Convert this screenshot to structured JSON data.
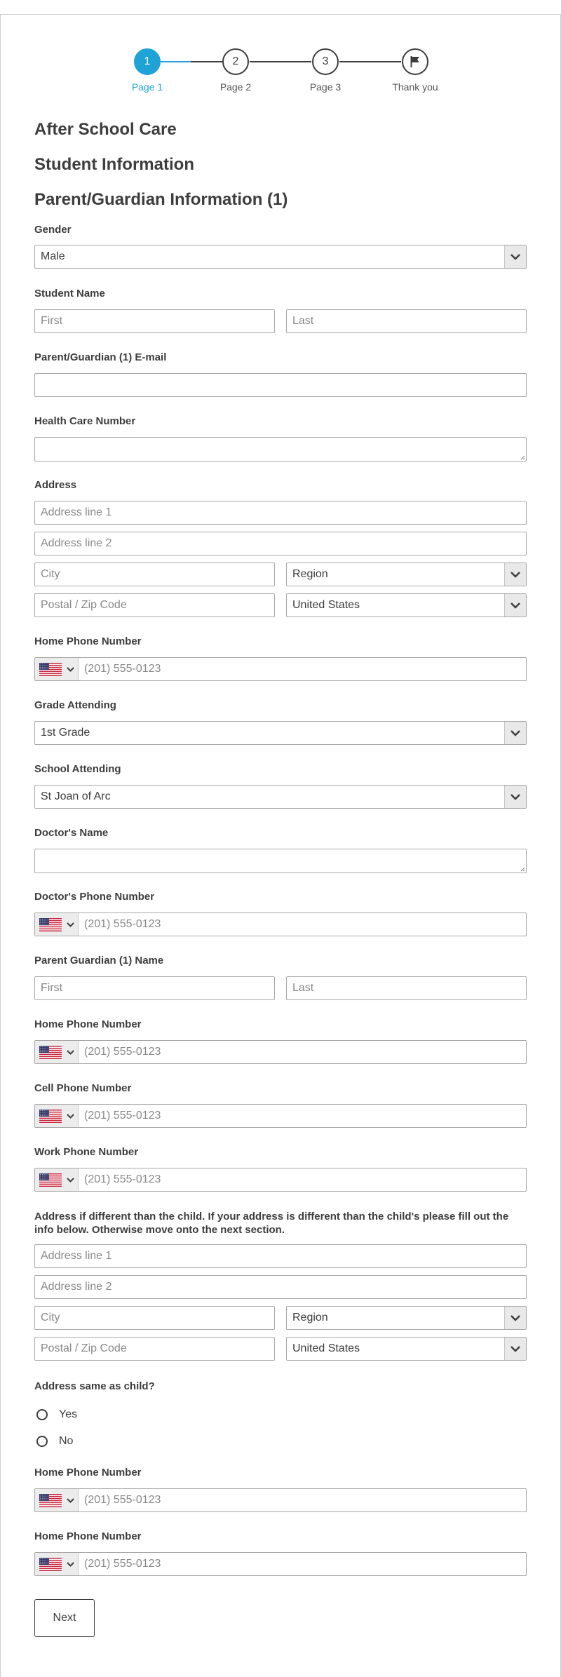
{
  "stepper": [
    {
      "number": "1",
      "label": "Page 1"
    },
    {
      "number": "2",
      "label": "Page 2"
    },
    {
      "number": "3",
      "label": "Page 3"
    },
    {
      "icon": "flag-icon",
      "label": "Thank you"
    }
  ],
  "headings": {
    "form_title": "After School Care",
    "section_student": "Student Information",
    "section_parent": "Parent/Guardian Information (1)"
  },
  "gender": {
    "label": "Gender",
    "value": "Male"
  },
  "student_name": {
    "label": "Student Name",
    "first_placeholder": "First",
    "last_placeholder": "Last"
  },
  "parent_email": {
    "label": "Parent/Guardian (1) E-mail",
    "value": ""
  },
  "health_care": {
    "label": "Health Care Number",
    "value": ""
  },
  "address": {
    "label": "Address",
    "line1_placeholder": "Address line 1",
    "line2_placeholder": "Address line 2",
    "city_placeholder": "City",
    "region_value": "Region",
    "postal_placeholder": "Postal / Zip Code",
    "country_value": "United States"
  },
  "home_phone": {
    "label": "Home Phone Number",
    "placeholder": "(201) 555-0123"
  },
  "grade": {
    "label": "Grade Attending",
    "value": "1st Grade"
  },
  "school": {
    "label": "School Attending",
    "value": "St Joan of Arc"
  },
  "doctor_name": {
    "label": "Doctor's Name",
    "value": ""
  },
  "doctor_phone": {
    "label": "Doctor's Phone Number",
    "placeholder": "(201) 555-0123"
  },
  "guardian_name": {
    "label": "Parent Guardian (1) Name",
    "first_placeholder": "First",
    "last_placeholder": "Last"
  },
  "guardian_home_phone": {
    "label": "Home Phone Number",
    "placeholder": "(201) 555-0123"
  },
  "cell_phone": {
    "label": "Cell Phone Number",
    "placeholder": "(201) 555-0123"
  },
  "work_phone": {
    "label": "Work Phone Number",
    "placeholder": "(201) 555-0123"
  },
  "alt_address": {
    "label": "Address if different than the child. If your address is different than the child's please fill out the info below. Otherwise move onto the next section.",
    "line1_placeholder": "Address line 1",
    "line2_placeholder": "Address line 2",
    "city_placeholder": "City",
    "region_value": "Region",
    "postal_placeholder": "Postal / Zip Code",
    "country_value": "United States"
  },
  "same_address": {
    "label": "Address same as child?",
    "options": [
      "Yes",
      "No"
    ]
  },
  "home_phone_2": {
    "label": "Home Phone Number",
    "placeholder": "(201) 555-0123"
  },
  "home_phone_3": {
    "label": "Home Phone Number",
    "placeholder": "(201) 555-0123"
  },
  "next_button": "Next",
  "colors": {
    "accent": "#1fa3d6",
    "text": "#3d3d3d",
    "border": "#a8a8a8"
  }
}
